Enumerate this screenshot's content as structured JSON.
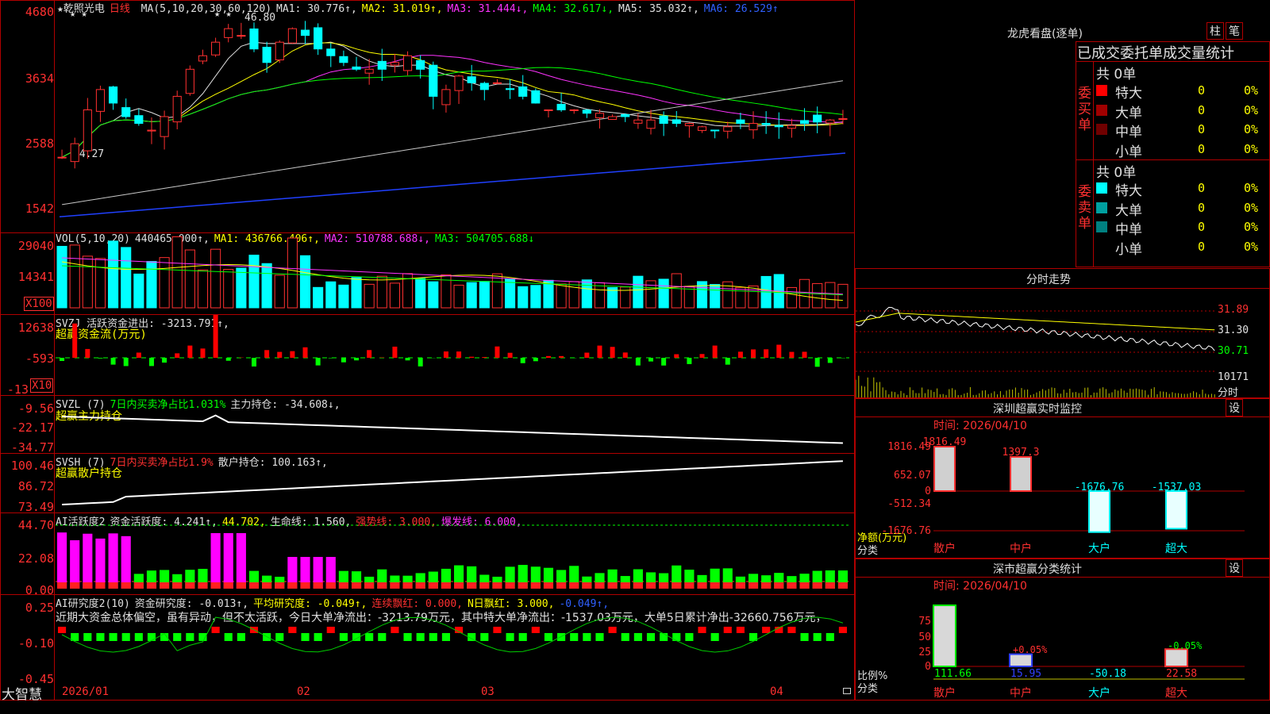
{
  "stock": {
    "name": "★乾照光电",
    "period": "日线",
    "marks": "★ ★",
    "marks2": "★ ★"
  },
  "k": {
    "ma_legend": [
      {
        "t": "MA(5,10,20,30,60,120)",
        "c": "w"
      },
      {
        "t": "MA1: 30.776↑,",
        "c": "w"
      },
      {
        "t": "MA2: 31.019↑,",
        "c": "y"
      },
      {
        "t": "MA3: 31.444↓,",
        "c": "m"
      },
      {
        "t": "MA4: 32.617↓,",
        "c": "g"
      },
      {
        "t": "MA5: 35.032↑,",
        "c": "w"
      },
      {
        "t": "MA6: 26.529↑",
        "c": "b"
      }
    ],
    "axis": [
      "4680",
      "3634",
      "2588",
      "1542"
    ],
    "high_label": "46.80",
    "low_label": "24.27"
  },
  "vol": {
    "legend": [
      {
        "t": "VOL(5,10,20)",
        "c": "w"
      },
      {
        "t": "440465.000↑,",
        "c": "w"
      },
      {
        "t": "MA1: 436766.406↑,",
        "c": "y"
      },
      {
        "t": "MA2: 510788.688↓,",
        "c": "m"
      },
      {
        "t": "MA3: 504705.688↓",
        "c": "g"
      }
    ],
    "axis": [
      "29040",
      "14341"
    ],
    "unit": "X100"
  },
  "svzj": {
    "legend": [
      {
        "t": "SVZJ  活跃资金进出: -3213.791↑,",
        "c": "w"
      }
    ],
    "sub": "超赢资金流(万元)",
    "axis": [
      "12638",
      "-593",
      "-13"
    ],
    "unit": "X10"
  },
  "svzl": {
    "legend": [
      {
        "t": "SVZL (7)",
        "c": "w"
      },
      {
        "t": "7日内买卖净占比1.031%",
        "c": "g"
      },
      {
        "t": "主力持仓: -34.608↓,",
        "c": "w"
      }
    ],
    "sub": "超赢主力持仓",
    "axis": [
      "-9.56",
      "-22.17",
      "-34.77"
    ]
  },
  "svsh": {
    "legend": [
      {
        "t": "SVSH (7)",
        "c": "w"
      },
      {
        "t": "7日内买卖净占比1.9%",
        "c": "r"
      },
      {
        "t": "散户持仓: 100.163↑,",
        "c": "w"
      }
    ],
    "sub": "超赢散户持仓",
    "axis": [
      "100.46",
      "86.72",
      "73.49"
    ]
  },
  "ai1": {
    "legend": [
      {
        "t": "AI活跃度2",
        "c": "w"
      },
      {
        "t": "资金活跃度: 4.241↑,",
        "c": "w"
      },
      {
        "t": "44.702,",
        "c": "y"
      },
      {
        "t": "生命线: 1.560,",
        "c": "w"
      },
      {
        "t": "强势线: 3.000,",
        "c": "r"
      },
      {
        "t": "爆发线: 6.000,",
        "c": "m"
      }
    ],
    "axis": [
      "44.70",
      "22.08",
      "0.00"
    ]
  },
  "ai2": {
    "legend": [
      {
        "t": "AI研究度2(10)",
        "c": "w"
      },
      {
        "t": "资金研究度: -0.013↑,",
        "c": "w"
      },
      {
        "t": "平均研究度: -0.049↑,",
        "c": "y"
      },
      {
        "t": "连续飘红: 0.000,",
        "c": "r"
      },
      {
        "t": "N日飘红: 3.000,",
        "c": "y"
      },
      {
        "t": "-0.049↑,",
        "c": "b"
      }
    ],
    "comment": "近期大资金总体偏空，虽有异动，但不太活跃，今日大单净流出：-3213.79万元，其中特大单净流出：-1537.03万元，大单5日累计净出-32660.756万元，",
    "axis": [
      "0.25",
      "-0.10",
      "-0.45"
    ]
  },
  "dates": [
    "2026/01",
    "02",
    "03",
    "04"
  ],
  "bottom_brand": "大智慧",
  "lhb": {
    "title": "龙虎看盘(逐单)",
    "btn_zhu": "柱",
    "btn_bi": "笔",
    "subtitle": "已成交委托单成交量统计",
    "buy_label": "委买单",
    "sell_label": "委卖单",
    "buy_total": "共 0单",
    "sell_total": "共 0单",
    "buy_rows": [
      {
        "name": "特大",
        "vol": "0",
        "pct": "0%",
        "color": "#ff0000"
      },
      {
        "name": "大单",
        "vol": "0",
        "pct": "0%",
        "color": "#a00000"
      },
      {
        "name": "中单",
        "vol": "0",
        "pct": "0%",
        "color": "#700000"
      },
      {
        "name": "小单",
        "vol": "0",
        "pct": "0%",
        "color": ""
      }
    ],
    "sell_rows": [
      {
        "name": "特大",
        "vol": "0",
        "pct": "0%",
        "color": "#00ffff"
      },
      {
        "name": "大单",
        "vol": "0",
        "pct": "0%",
        "color": "#00a0a0"
      },
      {
        "name": "中单",
        "vol": "0",
        "pct": "0%",
        "color": "#008080"
      },
      {
        "name": "小单",
        "vol": "0",
        "pct": "0%",
        "color": ""
      }
    ]
  },
  "fenshi": {
    "title": "分时走势",
    "axis": [
      "31.89",
      "31.30",
      "30.71"
    ],
    "vol_axis": "10171",
    "label": "分时"
  },
  "monitor": {
    "title": "深圳超赢实时监控",
    "set": "设",
    "time": "时间: 2026/04/10",
    "axis": [
      "1816.49",
      "652.07",
      "0",
      "-512.34",
      "-1676.76"
    ],
    "ylabel": "净额(万元)",
    "xlabel": "分类",
    "categories": [
      "散户",
      "中户",
      "大户",
      "超大"
    ],
    "values": [
      "1816.49",
      "1397.3",
      "-1676.76",
      "-1537.03"
    ]
  },
  "classify": {
    "title": "深市超赢分类统计",
    "set": "设",
    "time": "时间: 2026/04/10",
    "axis": [
      "75",
      "50",
      "25",
      "0"
    ],
    "ylabel": "比例%",
    "xlabel": "分类",
    "categories": [
      "散户",
      "中户",
      "大户",
      "超大"
    ],
    "values": [
      "111.66",
      "15.95",
      "-50.18",
      "22.58"
    ],
    "changes": [
      "+0.05%",
      "-0.05%"
    ]
  },
  "chart_data": [
    {
      "type": "line",
      "title": "乾照光电 日线",
      "ylim": [
        15.42,
        46.8
      ],
      "series": [
        {
          "name": "MA1",
          "last": 30.776
        },
        {
          "name": "MA2",
          "last": 31.019
        },
        {
          "name": "MA3",
          "last": 31.444
        },
        {
          "name": "MA4",
          "last": 32.617
        },
        {
          "name": "MA5",
          "last": 35.032
        },
        {
          "name": "MA6",
          "last": 26.529
        }
      ],
      "annotations": [
        {
          "text": "46.80"
        },
        {
          "text": "24.27"
        }
      ]
    },
    {
      "type": "bar",
      "title": "深圳超赢实时监控",
      "categories": [
        "散户",
        "中户",
        "大户",
        "超大"
      ],
      "values": [
        1816.49,
        1397.3,
        -1676.76,
        -1537.03
      ],
      "ylabel": "净额(万元)",
      "ylim": [
        -1676.76,
        1816.49
      ]
    },
    {
      "type": "bar",
      "title": "深市超赢分类统计",
      "categories": [
        "散户",
        "中户",
        "大户",
        "超大"
      ],
      "values": [
        111.66,
        15.95,
        -50.18,
        22.58
      ],
      "ylabel": "比例%"
    }
  ]
}
